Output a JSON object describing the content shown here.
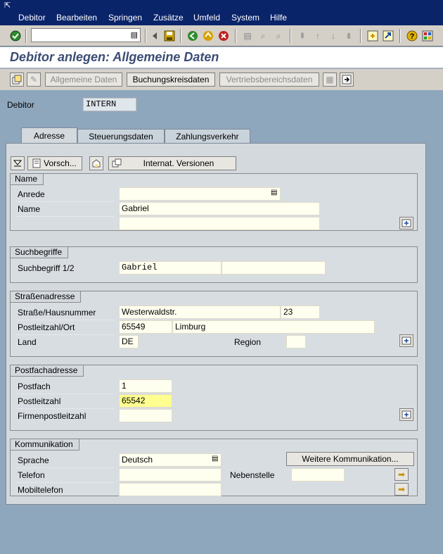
{
  "menu": {
    "items": [
      "Debitor",
      "Bearbeiten",
      "Springen",
      "Zusätze",
      "Umfeld",
      "System",
      "Hilfe"
    ]
  },
  "header": {
    "title": "Debitor anlegen: Allgemeine Daten"
  },
  "appbar": {
    "allgemeine": "Allgemeine Daten",
    "buchungskreis": "Buchungskreisdaten",
    "vertriebsbereich": "Vertriebsbereichsdaten"
  },
  "debitor": {
    "label": "Debitor",
    "value": "INTERN"
  },
  "tabs": [
    {
      "label": "Adresse"
    },
    {
      "label": "Steuerungsdaten"
    },
    {
      "label": "Zahlungsverkehr"
    }
  ],
  "panel_toolbar": {
    "vorschau": "Vorsch...",
    "internat": "Internat. Versionen"
  },
  "name_group": {
    "title": "Name",
    "anrede_label": "Anrede",
    "anrede_value": "",
    "name_label": "Name",
    "name_value": "Gabriel",
    "name2_value": ""
  },
  "such_group": {
    "title": "Suchbegriffe",
    "label": "Suchbegriff 1/2",
    "value1": "Gabriel",
    "value2": ""
  },
  "strasse_group": {
    "title": "Straßenadresse",
    "strasse_label": "Straße/Hausnummer",
    "strasse_value": "Westerwaldstr.",
    "hausnr_value": "23",
    "plz_label": "Postleitzahl/Ort",
    "plz_value": "65549",
    "ort_value": "Limburg",
    "land_label": "Land",
    "land_value": "DE",
    "region_label": "Region",
    "region_value": ""
  },
  "postfach_group": {
    "title": "Postfachadresse",
    "postfach_label": "Postfach",
    "postfach_value": "1",
    "plz_label": "Postleitzahl",
    "plz_value": "65542",
    "firmen_label": "Firmenpostleitzahl",
    "firmen_value": ""
  },
  "komm_group": {
    "title": "Kommunikation",
    "sprache_label": "Sprache",
    "sprache_value": "Deutsch",
    "weitere": "Weitere Kommunikation...",
    "telefon_label": "Telefon",
    "telefon_value": "",
    "nebenstelle_label": "Nebenstelle",
    "nebenstelle_value": "",
    "mobil_label": "Mobiltelefon",
    "mobil_value": ""
  },
  "colors": {
    "window_bg": "#8fa7bd",
    "menubar": "#0a246a",
    "title_text": "#3c4d74",
    "highlight_field": "#ffff90"
  }
}
